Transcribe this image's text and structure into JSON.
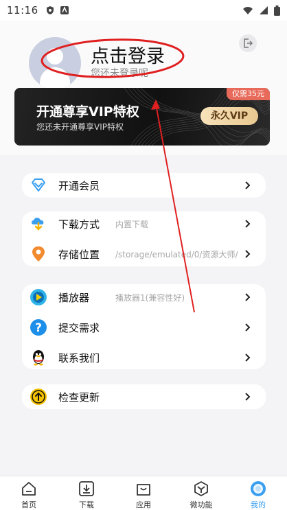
{
  "status_bar": {
    "time": "11:16"
  },
  "header": {
    "login_title": "点击登录",
    "login_subtitle": "您还未登录呢"
  },
  "vip": {
    "title": "开通尊享VIP特权",
    "subtitle": "您还未开通尊享VIP特权",
    "price_badge": "仅需35元",
    "button_label": "永久VIP"
  },
  "menu": {
    "member": {
      "label": "开通会员"
    },
    "download_method": {
      "label": "下载方式",
      "value": "内置下载"
    },
    "storage": {
      "label": "存储位置",
      "value": "/storage/emulated/0/资源大师/"
    },
    "player": {
      "label": "播放器",
      "value": "播放器1(兼容性好)"
    },
    "feedback": {
      "label": "提交需求"
    },
    "contact": {
      "label": "联系我们"
    },
    "update": {
      "label": "检查更新"
    }
  },
  "bottom_nav": {
    "home": "首页",
    "download": "下载",
    "apps": "应用",
    "tools": "微功能",
    "mine": "我的"
  },
  "colors": {
    "accent": "#3b9ff0",
    "vip_badge": "#e86a5a",
    "annotation": "#e02020"
  }
}
